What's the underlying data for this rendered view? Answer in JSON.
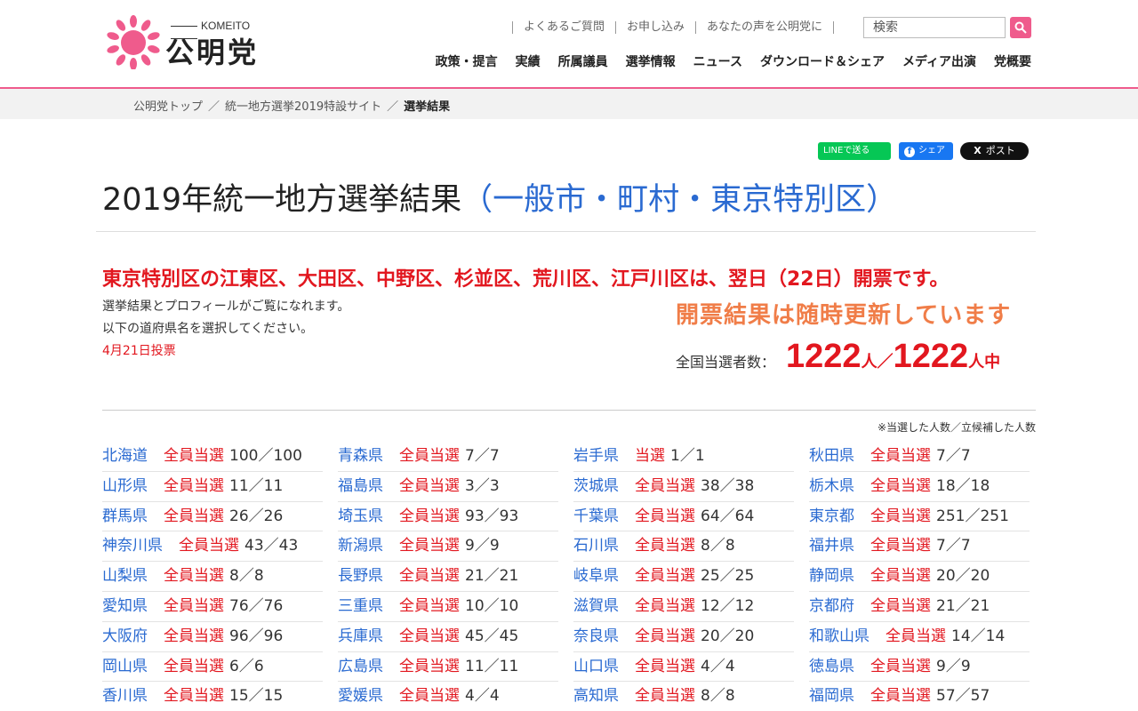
{
  "header": {
    "logo_romaji": "KOMEITO",
    "logo_kanji": "公明党",
    "utility_links": [
      "よくあるご質問",
      "お申し込み",
      "あなたの声を公明党に"
    ],
    "search_placeholder": "検索",
    "nav": [
      "政策・提言",
      "実績",
      "所属議員",
      "選挙情報",
      "ニュース",
      "ダウンロード＆シェア",
      "メディア出演",
      "党概要"
    ],
    "brand_color": "#ef5b8c"
  },
  "breadcrumb": {
    "items": [
      "公明党トップ",
      "統一地方選挙2019特設サイト"
    ],
    "separator": "／",
    "current": "選挙結果"
  },
  "share": {
    "line": "LINEで送る",
    "facebook": "シェア",
    "x": "ポスト"
  },
  "page": {
    "title_main": "2019年統一地方選挙結果",
    "title_sub": "（一般市・町村・東京特別区）",
    "alert": "東京特別区の江東区、大田区、中野区、杉並区、荒川区、江戸川区は、翌日（22日）開票です。",
    "desc_line1": "選挙結果とプロフィールがご覧になれます。",
    "desc_line2": "以下の道府県名を選択してください。",
    "vote_date": "4月21日投票",
    "updating": "開票結果は随時更新しています",
    "total_label": "全国当選者数：",
    "elected": "1222",
    "unit_elected": "人／",
    "candidates": "1222",
    "unit_candidates": "人中",
    "note": "※当選した人数／立候補した人数"
  },
  "results": [
    {
      "pref": "北海道",
      "status": "全員当選",
      "count": "100／100"
    },
    {
      "pref": "青森県",
      "status": "全員当選",
      "count": "7／7"
    },
    {
      "pref": "岩手県",
      "status": "当選",
      "count": "1／1"
    },
    {
      "pref": "秋田県",
      "status": "全員当選",
      "count": "7／7"
    },
    {
      "pref": "山形県",
      "status": "全員当選",
      "count": "11／11"
    },
    {
      "pref": "福島県",
      "status": "全員当選",
      "count": "3／3"
    },
    {
      "pref": "茨城県",
      "status": "全員当選",
      "count": "38／38"
    },
    {
      "pref": "栃木県",
      "status": "全員当選",
      "count": "18／18"
    },
    {
      "pref": "群馬県",
      "status": "全員当選",
      "count": "26／26"
    },
    {
      "pref": "埼玉県",
      "status": "全員当選",
      "count": "93／93"
    },
    {
      "pref": "千葉県",
      "status": "全員当選",
      "count": "64／64"
    },
    {
      "pref": "東京都",
      "status": "全員当選",
      "count": "251／251"
    },
    {
      "pref": "神奈川県",
      "status": "全員当選",
      "count": "43／43"
    },
    {
      "pref": "新潟県",
      "status": "全員当選",
      "count": "9／9"
    },
    {
      "pref": "石川県",
      "status": "全員当選",
      "count": "8／8"
    },
    {
      "pref": "福井県",
      "status": "全員当選",
      "count": "7／7"
    },
    {
      "pref": "山梨県",
      "status": "全員当選",
      "count": "8／8"
    },
    {
      "pref": "長野県",
      "status": "全員当選",
      "count": "21／21"
    },
    {
      "pref": "岐阜県",
      "status": "全員当選",
      "count": "25／25"
    },
    {
      "pref": "静岡県",
      "status": "全員当選",
      "count": "20／20"
    },
    {
      "pref": "愛知県",
      "status": "全員当選",
      "count": "76／76"
    },
    {
      "pref": "三重県",
      "status": "全員当選",
      "count": "10／10"
    },
    {
      "pref": "滋賀県",
      "status": "全員当選",
      "count": "12／12"
    },
    {
      "pref": "京都府",
      "status": "全員当選",
      "count": "21／21"
    },
    {
      "pref": "大阪府",
      "status": "全員当選",
      "count": "96／96"
    },
    {
      "pref": "兵庫県",
      "status": "全員当選",
      "count": "45／45"
    },
    {
      "pref": "奈良県",
      "status": "全員当選",
      "count": "20／20"
    },
    {
      "pref": "和歌山県",
      "status": "全員当選",
      "count": "14／14"
    },
    {
      "pref": "岡山県",
      "status": "全員当選",
      "count": "6／6"
    },
    {
      "pref": "広島県",
      "status": "全員当選",
      "count": "11／11"
    },
    {
      "pref": "山口県",
      "status": "全員当選",
      "count": "4／4"
    },
    {
      "pref": "徳島県",
      "status": "全員当選",
      "count": "9／9"
    },
    {
      "pref": "香川県",
      "status": "全員当選",
      "count": "15／15"
    },
    {
      "pref": "愛媛県",
      "status": "全員当選",
      "count": "4／4"
    },
    {
      "pref": "高知県",
      "status": "全員当選",
      "count": "8／8"
    },
    {
      "pref": "福岡県",
      "status": "全員当選",
      "count": "57／57"
    }
  ]
}
